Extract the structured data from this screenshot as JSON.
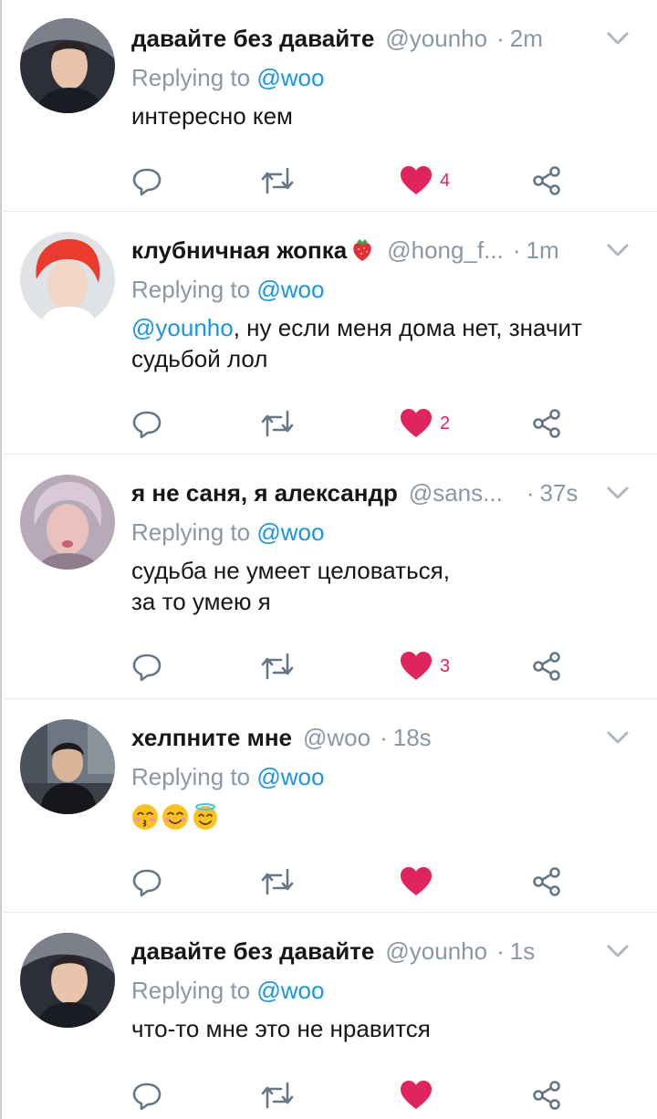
{
  "tweets": [
    {
      "name": "давайте без давайте",
      "handle": "@younho",
      "time": "2m",
      "reply_prefix": "Replying to",
      "reply_to": "@woo",
      "text": "интересно кем",
      "likes": "4"
    },
    {
      "name": "клубничная жопка",
      "handle": "@hong_f...",
      "time": "1m",
      "reply_prefix": "Replying to",
      "reply_to": "@woo",
      "mention": "@younho",
      "text_line1": ", ну если меня дома нет, значит",
      "text_line2": "судьбой лол",
      "likes": "2"
    },
    {
      "name": "я не саня, я александр",
      "handle": "@sans...",
      "time": "37s",
      "reply_prefix": "Replying to",
      "reply_to": "@woo",
      "text_line1": "судьба не умеет целоваться,",
      "text_line2": "за то умею я",
      "likes": "3"
    },
    {
      "name": "хелпните мне",
      "handle": "@woo",
      "time": "18s",
      "reply_prefix": "Replying to",
      "reply_to": "@woo",
      "emojis": [
        "kissing-face-icon",
        "smiling-face-icon",
        "halo-face-icon"
      ]
    },
    {
      "name": "давайте без давайте",
      "handle": "@younho",
      "time": "1s",
      "reply_prefix": "Replying to",
      "reply_to": "@woo",
      "text": "что-то мне это не нравится"
    }
  ],
  "separator": "·",
  "icons": {
    "reply": "reply-icon",
    "retweet": "retweet-icon",
    "like": "heart-icon",
    "share": "share-icon",
    "menu": "chevron-down-icon"
  },
  "colors": {
    "link": "#1b95e0",
    "like": "#e0245e",
    "secondary_text": "#8a98a5",
    "icon": "#657786",
    "divider": "#e6ecf0"
  }
}
